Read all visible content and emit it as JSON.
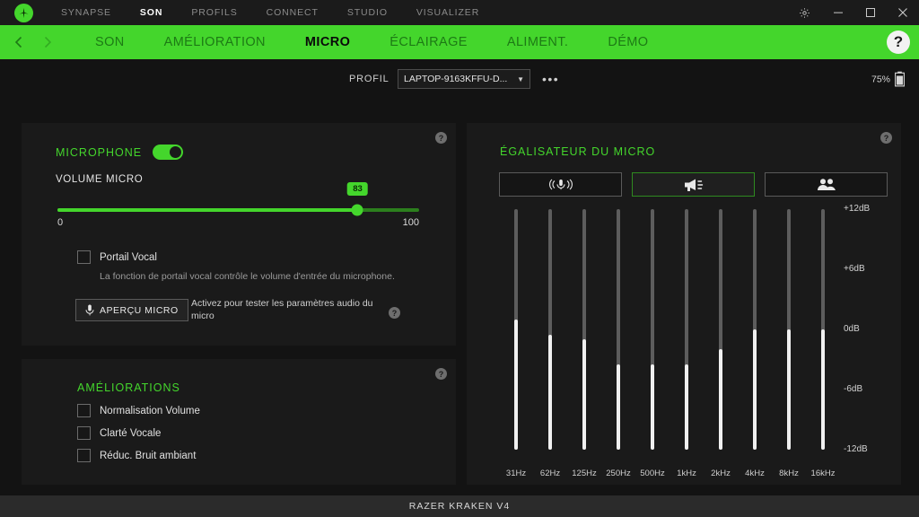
{
  "window": {
    "top_nav": [
      {
        "label": "SYNAPSE",
        "active": false
      },
      {
        "label": "SON",
        "active": true
      },
      {
        "label": "PROFILS",
        "active": false
      },
      {
        "label": "CONNECT",
        "active": false
      },
      {
        "label": "STUDIO",
        "active": false
      },
      {
        "label": "VISUALIZER",
        "active": false
      }
    ],
    "controls": {
      "settings": "gear-icon",
      "minimize": "minimize-icon",
      "maximize": "maximize-icon",
      "close": "close-icon"
    }
  },
  "tabbar": {
    "back": "chevron-left-icon",
    "forward": "chevron-right-icon",
    "tabs": [
      {
        "label": "SON",
        "active": false
      },
      {
        "label": "AMÉLIORATION",
        "active": false
      },
      {
        "label": "MICRO",
        "active": true
      },
      {
        "label": "ÉCLAIRAGE",
        "active": false
      },
      {
        "label": "ALIMENT.",
        "active": false
      },
      {
        "label": "DÉMO",
        "active": false
      }
    ],
    "help": "?"
  },
  "profile_row": {
    "label": "PROFIL",
    "selected": "LAPTOP-9163KFFU-D...",
    "more": "•••",
    "battery_pct": "75%"
  },
  "microphone_panel": {
    "title": "MICROPHONE",
    "toggle_on": true,
    "help": "?",
    "volume_label": "VOLUME MICRO",
    "volume_value": "83",
    "volume_min": "0",
    "volume_max": "100",
    "gate_checkbox": {
      "label": "Portail Vocal",
      "checked": false
    },
    "gate_description": "La fonction de portail vocal contrôle le volume d'entrée du microphone.",
    "preview_button": "APERÇU MICRO",
    "preview_description": "Activez pour tester les paramètres audio du micro",
    "preview_help": "?"
  },
  "enhancements_panel": {
    "title": "AMÉLIORATIONS",
    "help": "?",
    "items": [
      {
        "label": "Normalisation Volume",
        "checked": false
      },
      {
        "label": "Clarté Vocale",
        "checked": false
      },
      {
        "label": "Réduc. Bruit ambiant",
        "checked": false
      }
    ]
  },
  "equalizer_panel": {
    "title": "ÉGALISATEUR DU MICRO",
    "help": "?",
    "presets": [
      {
        "icon": "microphone-waves-icon",
        "active": false
      },
      {
        "icon": "megaphone-icon",
        "active": true
      },
      {
        "icon": "people-group-icon",
        "active": false
      }
    ]
  },
  "chart_data": {
    "type": "bar",
    "title": "ÉGALISATEUR DU MICRO",
    "xlabel": "",
    "ylabel": "dB",
    "ylim": [
      -12,
      12
    ],
    "yticks": [
      "+12dB",
      "+6dB",
      "0dB",
      "-6dB",
      "-12dB"
    ],
    "ytick_values": [
      12,
      6,
      0,
      -6,
      -12
    ],
    "categories": [
      "31Hz",
      "62Hz",
      "125Hz",
      "250Hz",
      "500Hz",
      "1kHz",
      "2kHz",
      "4kHz",
      "8kHz",
      "16kHz"
    ],
    "values": [
      1.0,
      -0.5,
      -1.0,
      -3.5,
      -3.5,
      -3.5,
      -2.0,
      0.0,
      0.0,
      0.0
    ],
    "grid": false,
    "legend": false
  },
  "footer": {
    "device": "RAZER KRAKEN V4"
  }
}
